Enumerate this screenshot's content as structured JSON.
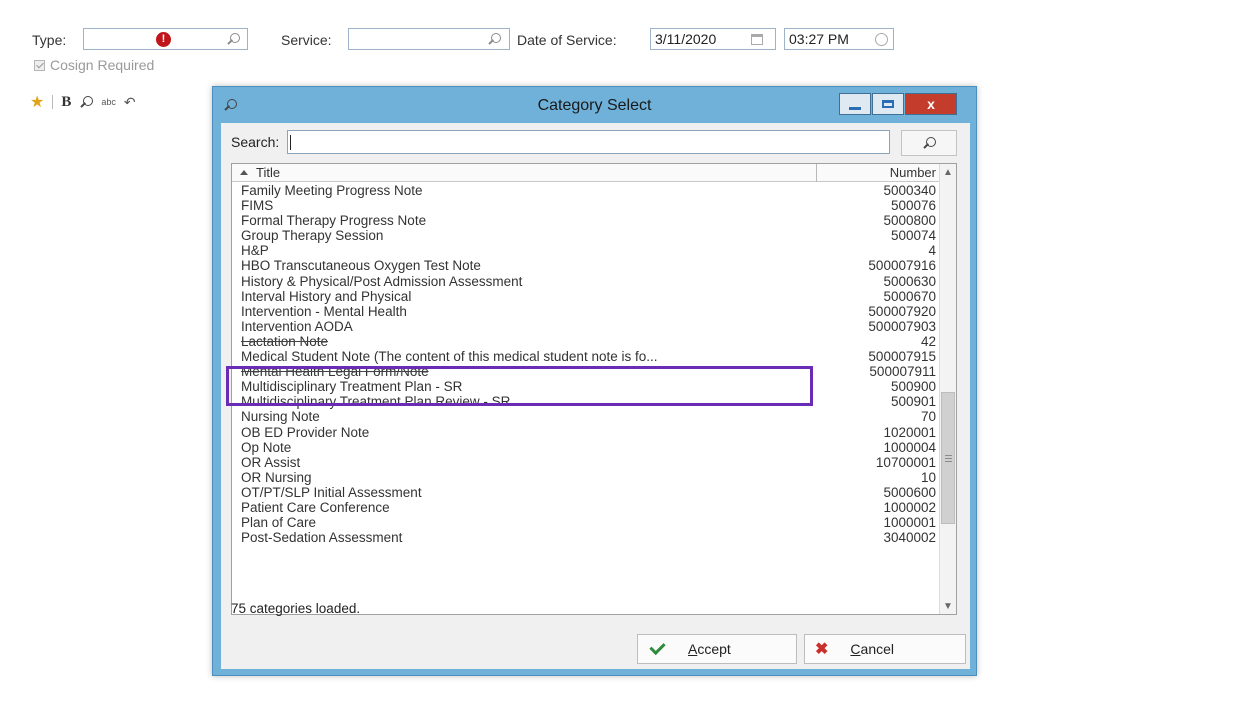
{
  "form": {
    "type_label": "Type:",
    "type_alert": "!",
    "service_label": "Service:",
    "date_label": "Date of Service:",
    "date_value": "3/11/2020",
    "time_value": "03:27 PM",
    "cosign_label": "Cosign Required",
    "toolbar_bold": "B",
    "toolbar_spell": "abc"
  },
  "dialog": {
    "title": "Category Select",
    "close_glyph": "x",
    "search_label": "Search:",
    "search_value": "",
    "col_title": "Title",
    "col_number": "Number",
    "rows": [
      {
        "title": "Family Meeting Progress Note",
        "number": "5000340"
      },
      {
        "title": "FIMS",
        "number": "500076"
      },
      {
        "title": "Formal Therapy Progress Note",
        "number": "5000800"
      },
      {
        "title": "Group Therapy Session",
        "number": "500074"
      },
      {
        "title": "H&P",
        "number": "4"
      },
      {
        "title": "HBO Transcutaneous Oxygen Test Note",
        "number": "500007916"
      },
      {
        "title": "History & Physical/Post Admission Assessment",
        "number": "5000630"
      },
      {
        "title": "Interval History and Physical",
        "number": "5000670"
      },
      {
        "title": "Intervention - Mental Health",
        "number": "500007920"
      },
      {
        "title": "Intervention AODA",
        "number": "500007903"
      },
      {
        "title": "Lactation Note",
        "number": "42"
      },
      {
        "title": "Medical Student Note (The content of this medical student note is fo...",
        "number": "500007915"
      },
      {
        "title": "Mental Health Legal Form/Note",
        "number": "500007911"
      },
      {
        "title": "Multidisciplinary Treatment Plan - SR",
        "number": "500900"
      },
      {
        "title": "Multidisciplinary Treatment Plan Review - SR",
        "number": "500901"
      },
      {
        "title": "Nursing Note",
        "number": "70"
      },
      {
        "title": "OB ED Provider Note",
        "number": "1020001"
      },
      {
        "title": "Op Note",
        "number": "1000004"
      },
      {
        "title": "OR Assist",
        "number": "10700001"
      },
      {
        "title": "OR Nursing",
        "number": "10"
      },
      {
        "title": "OT/PT/SLP Initial Assessment",
        "number": "5000600"
      },
      {
        "title": "Patient Care Conference",
        "number": "1000002"
      },
      {
        "title": "Plan of Care",
        "number": "1000001"
      },
      {
        "title": "Post-Sedation Assessment",
        "number": "3040002"
      }
    ],
    "status": "75 categories loaded.",
    "accept_first": "A",
    "accept_rest": "ccept",
    "cancel_first": "C",
    "cancel_rest": "ancel"
  },
  "colors": {
    "dialog_frame": "#6fb1d9",
    "highlight": "#6a2bb5",
    "close_button": "#c43c2c"
  }
}
